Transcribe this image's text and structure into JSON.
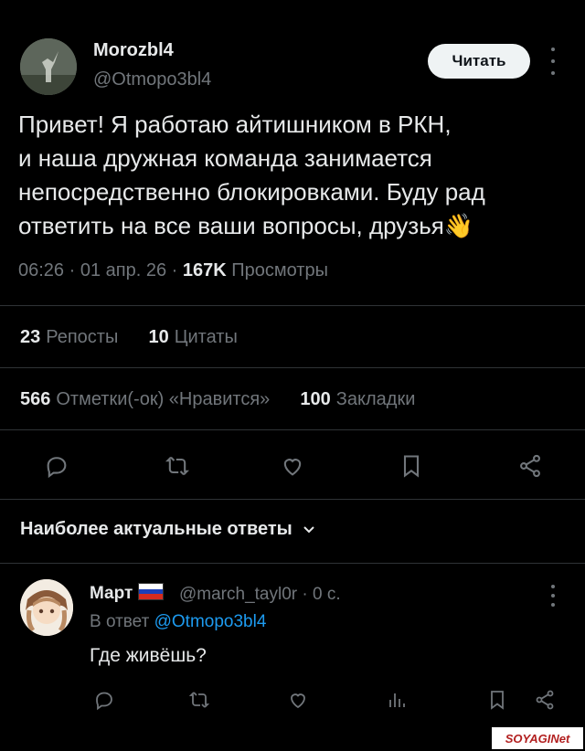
{
  "post": {
    "author_name": "Morozbl4",
    "author_handle": "@Otmopo3bl4",
    "read_button": "Читать",
    "text_lines": [
      "Привет! Я работаю айтишником в РКН,",
      "и наша дружная команда занимается",
      "непосредственно блокировками. Буду рад",
      "ответить на все ваши вопросы, друзья👋"
    ],
    "time": "06:26",
    "date": "01 апр. 26",
    "views_count": "167K",
    "views_label": "Просмотры",
    "reposts_count": "23",
    "reposts_label": "Репосты",
    "quotes_count": "10",
    "quotes_label": "Цитаты",
    "likes_count": "566",
    "likes_label": "Отметки(-ок) «Нравится»",
    "bookmarks_count": "100",
    "bookmarks_label": "Закладки"
  },
  "actions": {
    "icons": [
      "reply-icon",
      "repost-icon",
      "like-icon",
      "bookmark-icon",
      "share-icon"
    ]
  },
  "replies_header": {
    "label": "Наиболее актуальные ответы"
  },
  "reply": {
    "author_name": "Март",
    "author_handle": "@march_tayl0r",
    "time": "0 с.",
    "reply_to_prefix": "В ответ",
    "reply_to_handle": "@Otmopo3bl4",
    "text": "Где живёшь?",
    "flag_colors": [
      "#ffffff",
      "#1c3fb8",
      "#d52b1e"
    ]
  },
  "watermark": {
    "text": "SOYAGINet"
  },
  "colors": {
    "background": "#000000",
    "text": "#e7e9ea",
    "secondary": "#71767b",
    "link": "#1d9bf0",
    "divider": "#2f3336"
  }
}
